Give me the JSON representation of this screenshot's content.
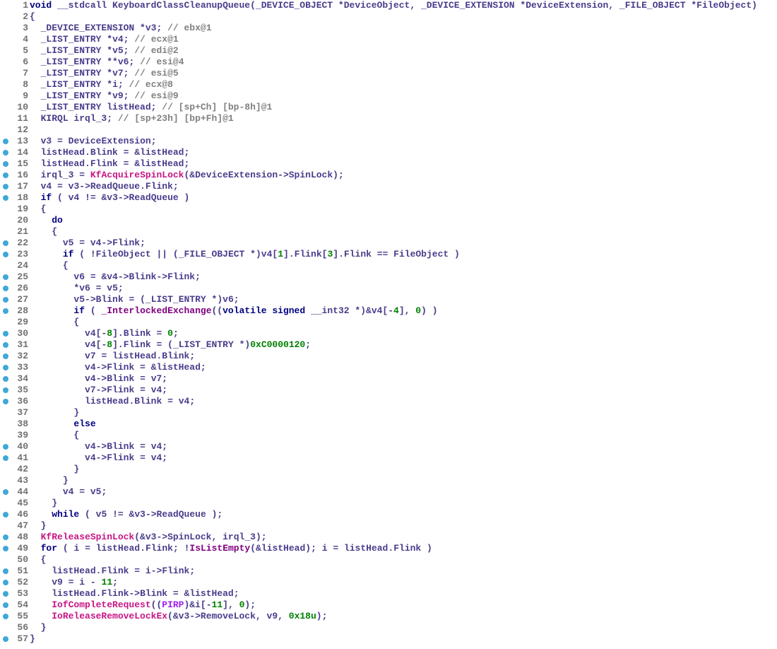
{
  "lines": [
    {
      "n": 1,
      "dot": false,
      "html": "<span class='kw'>void</span> <span class='id'>__stdcall KeyboardClassCleanupQueue</span><span class='br'>(</span><span class='id'>_DEVICE_OBJECT</span> <span class='op'>*</span><span class='id'>DeviceObject</span><span class='op'>,</span> <span class='id'>_DEVICE_EXTENSION</span> <span class='op'>*</span><span class='id'>DeviceExtension</span><span class='op'>,</span> <span class='id'>_FILE_OBJECT</span> <span class='op'>*</span><span class='id'>FileObject</span><span class='br'>)</span>"
    },
    {
      "n": 2,
      "dot": false,
      "html": "<span class='br'>{</span>"
    },
    {
      "n": 3,
      "dot": false,
      "html": "  <span class='id'>_DEVICE_EXTENSION</span> <span class='op'>*</span><span class='id'>v3</span><span class='op'>;</span> <span class='cmt'>// ebx@1</span>"
    },
    {
      "n": 4,
      "dot": false,
      "html": "  <span class='id'>_LIST_ENTRY</span> <span class='op'>*</span><span class='id'>v4</span><span class='op'>;</span> <span class='cmt'>// ecx@1</span>"
    },
    {
      "n": 5,
      "dot": false,
      "html": "  <span class='id'>_LIST_ENTRY</span> <span class='op'>*</span><span class='id'>v5</span><span class='op'>;</span> <span class='cmt'>// edi@2</span>"
    },
    {
      "n": 6,
      "dot": false,
      "html": "  <span class='id'>_LIST_ENTRY</span> <span class='op'>**</span><span class='id'>v6</span><span class='op'>;</span> <span class='cmt'>// esi@4</span>"
    },
    {
      "n": 7,
      "dot": false,
      "html": "  <span class='id'>_LIST_ENTRY</span> <span class='op'>*</span><span class='id'>v7</span><span class='op'>;</span> <span class='cmt'>// esi@5</span>"
    },
    {
      "n": 8,
      "dot": false,
      "html": "  <span class='id'>_LIST_ENTRY</span> <span class='op'>*</span><span class='id'>i</span><span class='op'>;</span> <span class='cmt'>// ecx@8</span>"
    },
    {
      "n": 9,
      "dot": false,
      "html": "  <span class='id'>_LIST_ENTRY</span> <span class='op'>*</span><span class='id'>v9</span><span class='op'>;</span> <span class='cmt'>// esi@9</span>"
    },
    {
      "n": 10,
      "dot": false,
      "html": "  <span class='id'>_LIST_ENTRY listHead</span><span class='op'>;</span> <span class='cmt'>// [sp+Ch] [bp-8h]@1</span>"
    },
    {
      "n": 11,
      "dot": false,
      "html": "  <span class='id'>KIRQL irql_3</span><span class='op'>;</span> <span class='cmt'>// [sp+23h] [bp+Fh]@1</span>"
    },
    {
      "n": 12,
      "dot": false,
      "html": ""
    },
    {
      "n": 13,
      "dot": true,
      "html": "  <span class='id'>v3</span> <span class='op'>=</span> <span class='id'>DeviceExtension</span><span class='op'>;</span>"
    },
    {
      "n": 14,
      "dot": true,
      "html": "  <span class='id'>listHead</span><span class='op'>.</span><span class='id'>Blink</span> <span class='op'>= &amp;</span><span class='id'>listHead</span><span class='op'>;</span>"
    },
    {
      "n": 15,
      "dot": true,
      "html": "  <span class='id'>listHead</span><span class='op'>.</span><span class='id'>Flink</span> <span class='op'>= &amp;</span><span class='id'>listHead</span><span class='op'>;</span>"
    },
    {
      "n": 16,
      "dot": true,
      "html": "  <span class='id'>irql_3</span> <span class='op'>=</span> <span class='fn'>KfAcquireSpinLock</span><span class='br'>(</span><span class='op'>&amp;</span><span class='id'>DeviceExtension</span><span class='op'>-&gt;</span><span class='id'>SpinLock</span><span class='br'>)</span><span class='op'>;</span>"
    },
    {
      "n": 17,
      "dot": true,
      "html": "  <span class='id'>v4</span> <span class='op'>=</span> <span class='id'>v3</span><span class='op'>-&gt;</span><span class='id'>ReadQueue</span><span class='op'>.</span><span class='id'>Flink</span><span class='op'>;</span>"
    },
    {
      "n": 18,
      "dot": true,
      "html": "  <span class='kw'>if</span> <span class='br'>(</span> <span class='id'>v4</span> <span class='op'>!= &amp;</span><span class='id'>v3</span><span class='op'>-&gt;</span><span class='id'>ReadQueue</span> <span class='br'>)</span>"
    },
    {
      "n": 19,
      "dot": false,
      "html": "  <span class='br'>{</span>"
    },
    {
      "n": 20,
      "dot": false,
      "html": "    <span class='kw'>do</span>"
    },
    {
      "n": 21,
      "dot": false,
      "html": "    <span class='br'>{</span>"
    },
    {
      "n": 22,
      "dot": true,
      "html": "      <span class='id'>v5</span> <span class='op'>=</span> <span class='id'>v4</span><span class='op'>-&gt;</span><span class='id'>Flink</span><span class='op'>;</span>"
    },
    {
      "n": 23,
      "dot": true,
      "html": "      <span class='kw'>if</span> <span class='br'>(</span> <span class='op'>!</span><span class='id'>FileObject</span> <span class='op'>||</span> <span class='br'>(</span><span class='id'>_FILE_OBJECT</span> <span class='op'>*</span><span class='br'>)</span><span class='id'>v4</span><span class='br'>[</span><span class='num'>1</span><span class='br'>]</span><span class='op'>.</span><span class='id'>Flink</span><span class='br'>[</span><span class='num'>3</span><span class='br'>]</span><span class='op'>.</span><span class='id'>Flink</span> <span class='op'>==</span> <span class='id'>FileObject</span> <span class='br'>)</span>"
    },
    {
      "n": 24,
      "dot": false,
      "html": "      <span class='br'>{</span>"
    },
    {
      "n": 25,
      "dot": true,
      "html": "        <span class='id'>v6</span> <span class='op'>= &amp;</span><span class='id'>v4</span><span class='op'>-&gt;</span><span class='id'>Blink</span><span class='op'>-&gt;</span><span class='id'>Flink</span><span class='op'>;</span>"
    },
    {
      "n": 26,
      "dot": true,
      "html": "        <span class='op'>*</span><span class='id'>v6</span> <span class='op'>=</span> <span class='id'>v5</span><span class='op'>;</span>"
    },
    {
      "n": 27,
      "dot": true,
      "html": "        <span class='id'>v5</span><span class='op'>-&gt;</span><span class='id'>Blink</span> <span class='op'>=</span> <span class='br'>(</span><span class='id'>_LIST_ENTRY</span> <span class='op'>*</span><span class='br'>)</span><span class='id'>v6</span><span class='op'>;</span>"
    },
    {
      "n": 28,
      "dot": true,
      "html": "        <span class='kw'>if</span> <span class='br'>(</span> <span class='glob'>_InterlockedExchange</span><span class='br'>((</span><span class='kw'>volatile signed</span> <span class='id'>__int32</span> <span class='op'>*</span><span class='br'>)</span><span class='op'>&amp;</span><span class='id'>v4</span><span class='br'>[</span><span class='op'>-</span><span class='num'>4</span><span class='br'>]</span><span class='op'>,</span> <span class='num'>0</span><span class='br'>)</span> <span class='br'>)</span>"
    },
    {
      "n": 29,
      "dot": false,
      "html": "        <span class='br'>{</span>"
    },
    {
      "n": 30,
      "dot": true,
      "html": "          <span class='id'>v4</span><span class='br'>[</span><span class='op'>-</span><span class='num'>8</span><span class='br'>]</span><span class='op'>.</span><span class='id'>Blink</span> <span class='op'>=</span> <span class='num'>0</span><span class='op'>;</span>"
    },
    {
      "n": 31,
      "dot": true,
      "html": "          <span class='id'>v4</span><span class='br'>[</span><span class='op'>-</span><span class='num'>8</span><span class='br'>]</span><span class='op'>.</span><span class='id'>Flink</span> <span class='op'>=</span> <span class='br'>(</span><span class='id'>_LIST_ENTRY</span> <span class='op'>*</span><span class='br'>)</span><span class='num'>0xC0000120</span><span class='op'>;</span>"
    },
    {
      "n": 32,
      "dot": true,
      "html": "          <span class='id'>v7</span> <span class='op'>=</span> <span class='id'>listHead</span><span class='op'>.</span><span class='id'>Blink</span><span class='op'>;</span>"
    },
    {
      "n": 33,
      "dot": true,
      "html": "          <span class='id'>v4</span><span class='op'>-&gt;</span><span class='id'>Flink</span> <span class='op'>= &amp;</span><span class='id'>listHead</span><span class='op'>;</span>"
    },
    {
      "n": 34,
      "dot": true,
      "html": "          <span class='id'>v4</span><span class='op'>-&gt;</span><span class='id'>Blink</span> <span class='op'>=</span> <span class='id'>v7</span><span class='op'>;</span>"
    },
    {
      "n": 35,
      "dot": true,
      "html": "          <span class='id'>v7</span><span class='op'>-&gt;</span><span class='id'>Flink</span> <span class='op'>=</span> <span class='id'>v4</span><span class='op'>;</span>"
    },
    {
      "n": 36,
      "dot": true,
      "html": "          <span class='id'>listHead</span><span class='op'>.</span><span class='id'>Blink</span> <span class='op'>=</span> <span class='id'>v4</span><span class='op'>;</span>"
    },
    {
      "n": 37,
      "dot": false,
      "html": "        <span class='br'>}</span>"
    },
    {
      "n": 38,
      "dot": false,
      "html": "        <span class='kw'>else</span>"
    },
    {
      "n": 39,
      "dot": false,
      "html": "        <span class='br'>{</span>"
    },
    {
      "n": 40,
      "dot": true,
      "html": "          <span class='id'>v4</span><span class='op'>-&gt;</span><span class='id'>Blink</span> <span class='op'>=</span> <span class='id'>v4</span><span class='op'>;</span>"
    },
    {
      "n": 41,
      "dot": true,
      "html": "          <span class='id'>v4</span><span class='op'>-&gt;</span><span class='id'>Flink</span> <span class='op'>=</span> <span class='id'>v4</span><span class='op'>;</span>"
    },
    {
      "n": 42,
      "dot": false,
      "html": "        <span class='br'>}</span>"
    },
    {
      "n": 43,
      "dot": false,
      "html": "      <span class='br'>}</span>"
    },
    {
      "n": 44,
      "dot": true,
      "html": "      <span class='id'>v4</span> <span class='op'>=</span> <span class='id'>v5</span><span class='op'>;</span>"
    },
    {
      "n": 45,
      "dot": false,
      "html": "    <span class='br'>}</span>"
    },
    {
      "n": 46,
      "dot": true,
      "html": "    <span class='kw'>while</span> <span class='br'>(</span> <span class='id'>v5</span> <span class='op'>!= &amp;</span><span class='id'>v3</span><span class='op'>-&gt;</span><span class='id'>ReadQueue</span> <span class='br'>)</span><span class='op'>;</span>"
    },
    {
      "n": 47,
      "dot": false,
      "html": "  <span class='br'>}</span>"
    },
    {
      "n": 48,
      "dot": true,
      "html": "  <span class='fn'>KfReleaseSpinLock</span><span class='br'>(</span><span class='op'>&amp;</span><span class='id'>v3</span><span class='op'>-&gt;</span><span class='id'>SpinLock</span><span class='op'>,</span> <span class='id'>irql_3</span><span class='br'>)</span><span class='op'>;</span>"
    },
    {
      "n": 49,
      "dot": true,
      "html": "  <span class='kw'>for</span> <span class='br'>(</span> <span class='id'>i</span> <span class='op'>=</span> <span class='id'>listHead</span><span class='op'>.</span><span class='id'>Flink</span><span class='op'>;</span> <span class='op'>!</span><span class='glob'>IsListEmpty</span><span class='br'>(</span><span class='op'>&amp;</span><span class='id'>listHead</span><span class='br'>)</span><span class='op'>;</span> <span class='id'>i</span> <span class='op'>=</span> <span class='id'>listHead</span><span class='op'>.</span><span class='id'>Flink</span> <span class='br'>)</span>"
    },
    {
      "n": 50,
      "dot": false,
      "html": "  <span class='br'>{</span>"
    },
    {
      "n": 51,
      "dot": true,
      "html": "    <span class='id'>listHead</span><span class='op'>.</span><span class='id'>Flink</span> <span class='op'>=</span> <span class='id'>i</span><span class='op'>-&gt;</span><span class='id'>Flink</span><span class='op'>;</span>"
    },
    {
      "n": 52,
      "dot": true,
      "html": "    <span class='id'>v9</span> <span class='op'>=</span> <span class='id'>i</span> <span class='op'>-</span> <span class='num'>11</span><span class='op'>;</span>"
    },
    {
      "n": 53,
      "dot": true,
      "html": "    <span class='id'>listHead</span><span class='op'>.</span><span class='id'>Flink</span><span class='op'>-&gt;</span><span class='id'>Blink</span> <span class='op'>= &amp;</span><span class='id'>listHead</span><span class='op'>;</span>"
    },
    {
      "n": 54,
      "dot": true,
      "html": "    <span class='fn'>IofCompleteRequest</span><span class='br'>((</span><span class='glob2'>PIRP</span><span class='br'>)</span><span class='op'>&amp;</span><span class='id'>i</span><span class='br'>[</span><span class='op'>-</span><span class='num'>11</span><span class='br'>]</span><span class='op'>,</span> <span class='num'>0</span><span class='br'>)</span><span class='op'>;</span>"
    },
    {
      "n": 55,
      "dot": true,
      "html": "    <span class='fn'>IoReleaseRemoveLockEx</span><span class='br'>(</span><span class='op'>&amp;</span><span class='id'>v3</span><span class='op'>-&gt;</span><span class='id'>RemoveLock</span><span class='op'>,</span> <span class='id'>v9</span><span class='op'>,</span> <span class='num'>0x18u</span><span class='br'>)</span><span class='op'>;</span>"
    },
    {
      "n": 56,
      "dot": false,
      "html": "  <span class='br'>}</span>"
    },
    {
      "n": 57,
      "dot": true,
      "html": "<span class='br'>}</span>"
    }
  ]
}
